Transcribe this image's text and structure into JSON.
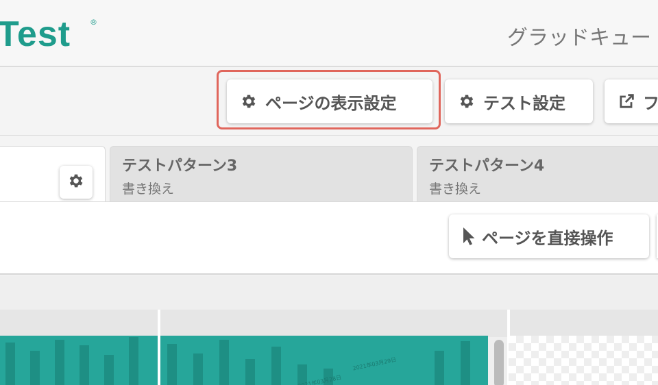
{
  "header": {
    "logo_text": "Test",
    "logo_mark": "®",
    "title": "グラッドキュー"
  },
  "toolbar": {
    "page_display_settings": {
      "label": "ページの表示設定",
      "icon": "gear-icon"
    },
    "test_settings": {
      "label": "テスト設定",
      "icon": "gear-icon"
    },
    "open_external": {
      "label": "フ",
      "icon": "external-link-icon"
    }
  },
  "tabs": [
    {
      "title": "",
      "subtitle": "",
      "active": true
    },
    {
      "title": "テストパターン3",
      "subtitle": "書き換え",
      "active": false
    },
    {
      "title": "テストパターン4",
      "subtitle": "書き換え",
      "active": false
    }
  ],
  "content": {
    "direct_operation_label": "ページを直接操作",
    "direct_operation_icon": "cursor-icon"
  },
  "preview": {
    "thumb_text_1": "2021年03月29日",
    "thumb_text_2": "2021年03月28日"
  },
  "colors": {
    "brand": "#1f9c8c",
    "highlight": "#e0665c",
    "thumb": "#26a69a"
  }
}
